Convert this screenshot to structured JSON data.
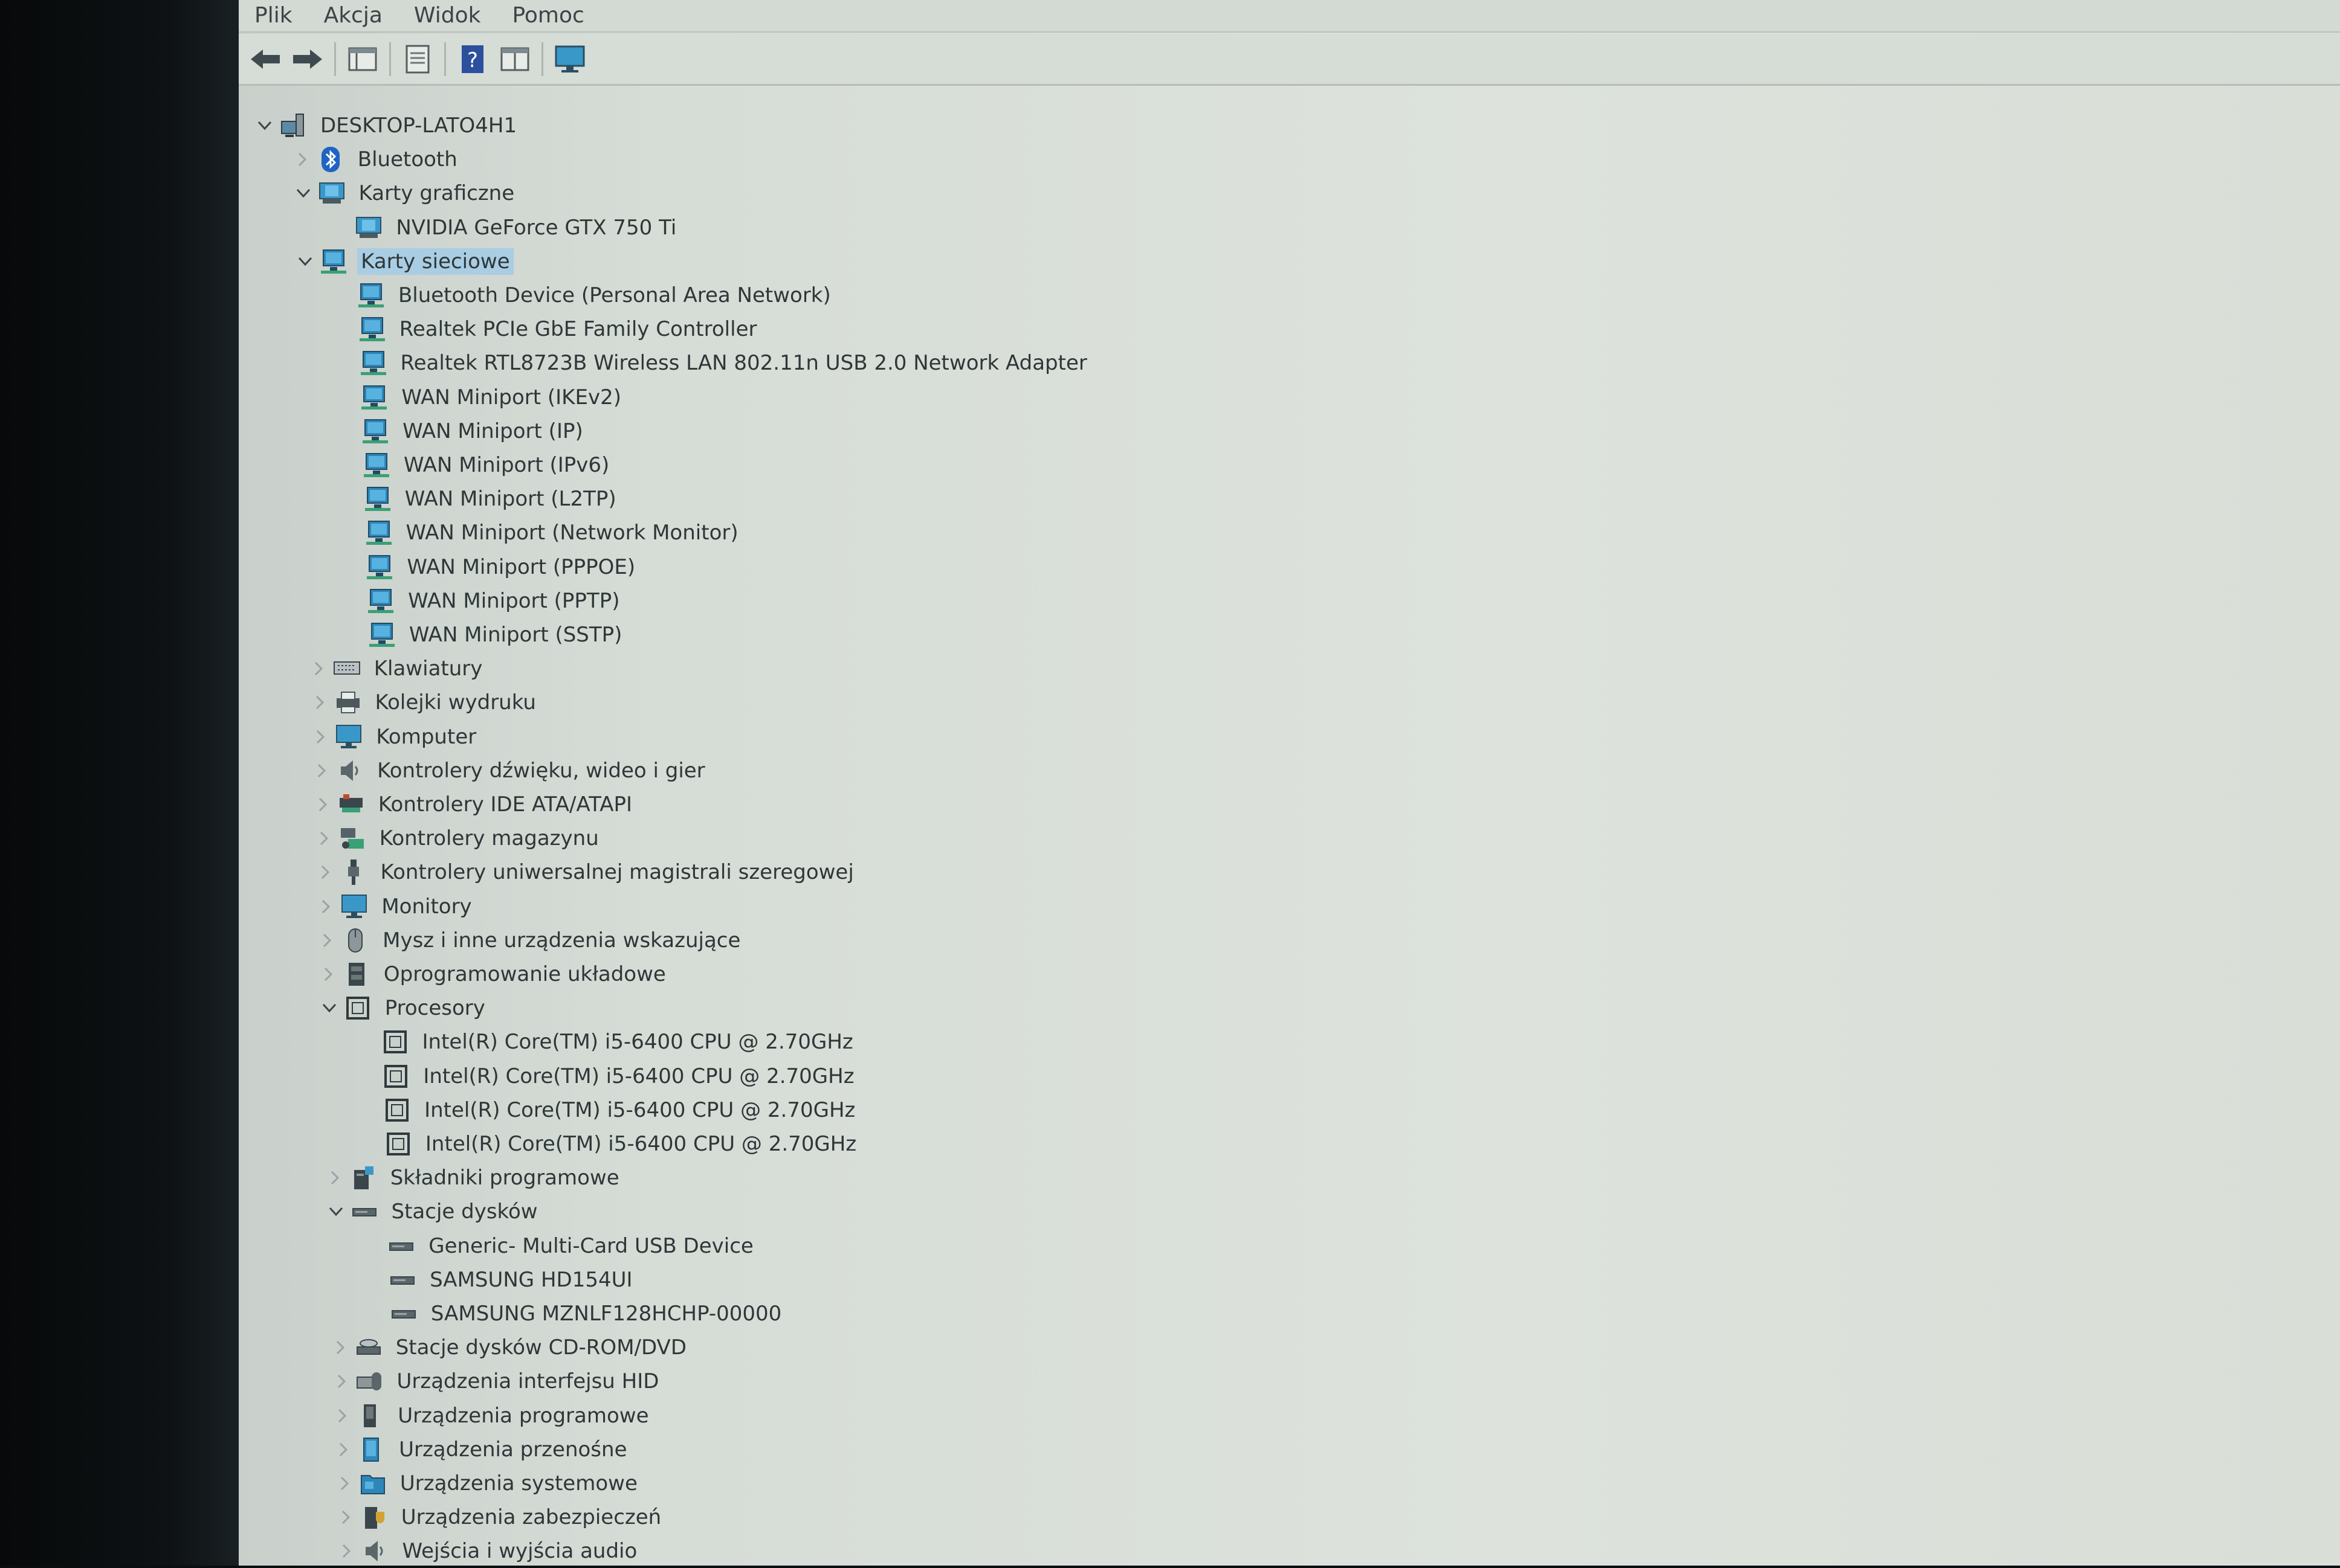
{
  "menu": [
    "Plik",
    "Akcja",
    "Widok",
    "Pomoc"
  ],
  "toolbar": {
    "buttons": [
      "back-arrow-icon",
      "forward-arrow-icon",
      "properties-window-icon",
      "document-list-icon",
      "help-icon",
      "panel-view-icon",
      "monitor-icon"
    ]
  },
  "tree": [
    {
      "label": "DESKTOP-LATO4H1",
      "level": 0,
      "toggle": "open",
      "icon": "computer-tower-icon"
    },
    {
      "label": "Bluetooth",
      "level": 1,
      "toggle": "closed",
      "icon": "bluetooth-icon"
    },
    {
      "label": "Karty graficzne",
      "level": 1,
      "toggle": "open",
      "icon": "display-adapter-icon"
    },
    {
      "label": "NVIDIA GeForce GTX 750 Ti",
      "level": 2,
      "toggle": "none",
      "icon": "display-adapter-icon"
    },
    {
      "label": "Karty sieciowe",
      "level": 1,
      "toggle": "open",
      "icon": "network-adapter-icon",
      "selected": true
    },
    {
      "label": "Bluetooth Device (Personal Area Network)",
      "level": 2,
      "toggle": "none",
      "icon": "network-adapter-icon"
    },
    {
      "label": "Realtek PCIe GbE Family Controller",
      "level": 2,
      "toggle": "none",
      "icon": "network-adapter-icon"
    },
    {
      "label": "Realtek RTL8723B Wireless LAN 802.11n USB 2.0 Network Adapter",
      "level": 2,
      "toggle": "none",
      "icon": "network-adapter-icon"
    },
    {
      "label": "WAN Miniport (IKEv2)",
      "level": 2,
      "toggle": "none",
      "icon": "network-adapter-icon"
    },
    {
      "label": "WAN Miniport (IP)",
      "level": 2,
      "toggle": "none",
      "icon": "network-adapter-icon"
    },
    {
      "label": "WAN Miniport (IPv6)",
      "level": 2,
      "toggle": "none",
      "icon": "network-adapter-icon"
    },
    {
      "label": "WAN Miniport (L2TP)",
      "level": 2,
      "toggle": "none",
      "icon": "network-adapter-icon"
    },
    {
      "label": "WAN Miniport (Network Monitor)",
      "level": 2,
      "toggle": "none",
      "icon": "network-adapter-icon"
    },
    {
      "label": "WAN Miniport (PPPOE)",
      "level": 2,
      "toggle": "none",
      "icon": "network-adapter-icon"
    },
    {
      "label": "WAN Miniport (PPTP)",
      "level": 2,
      "toggle": "none",
      "icon": "network-adapter-icon"
    },
    {
      "label": "WAN Miniport (SSTP)",
      "level": 2,
      "toggle": "none",
      "icon": "network-adapter-icon"
    },
    {
      "label": "Klawiatury",
      "level": 1,
      "toggle": "closed",
      "icon": "keyboard-icon"
    },
    {
      "label": "Kolejki wydruku",
      "level": 1,
      "toggle": "closed",
      "icon": "printer-icon"
    },
    {
      "label": "Komputer",
      "level": 1,
      "toggle": "closed",
      "icon": "monitor-icon"
    },
    {
      "label": "Kontrolery dźwięku, wideo i gier",
      "level": 1,
      "toggle": "closed",
      "icon": "speaker-icon"
    },
    {
      "label": "Kontrolery IDE ATA/ATAPI",
      "level": 1,
      "toggle": "closed",
      "icon": "ide-controller-icon"
    },
    {
      "label": "Kontrolery magazynu",
      "level": 1,
      "toggle": "closed",
      "icon": "storage-controller-icon"
    },
    {
      "label": "Kontrolery uniwersalnej magistrali szeregowej",
      "level": 1,
      "toggle": "closed",
      "icon": "usb-plug-icon"
    },
    {
      "label": "Monitory",
      "level": 1,
      "toggle": "closed",
      "icon": "monitor-icon"
    },
    {
      "label": "Mysz i inne urządzenia wskazujące",
      "level": 1,
      "toggle": "closed",
      "icon": "mouse-icon"
    },
    {
      "label": "Oprogramowanie układowe",
      "level": 1,
      "toggle": "closed",
      "icon": "firmware-chip-icon"
    },
    {
      "label": "Procesory",
      "level": 1,
      "toggle": "open",
      "icon": "processor-icon"
    },
    {
      "label": "Intel(R) Core(TM) i5-6400 CPU @ 2.70GHz",
      "level": 2,
      "toggle": "none",
      "icon": "processor-icon"
    },
    {
      "label": "Intel(R) Core(TM) i5-6400 CPU @ 2.70GHz",
      "level": 2,
      "toggle": "none",
      "icon": "processor-icon"
    },
    {
      "label": "Intel(R) Core(TM) i5-6400 CPU @ 2.70GHz",
      "level": 2,
      "toggle": "none",
      "icon": "processor-icon"
    },
    {
      "label": "Intel(R) Core(TM) i5-6400 CPU @ 2.70GHz",
      "level": 2,
      "toggle": "none",
      "icon": "processor-icon"
    },
    {
      "label": "Składniki programowe",
      "level": 1,
      "toggle": "closed",
      "icon": "software-component-icon"
    },
    {
      "label": "Stacje dysków",
      "level": 1,
      "toggle": "open",
      "icon": "disk-drive-icon"
    },
    {
      "label": "Generic- Multi-Card USB Device",
      "level": 2,
      "toggle": "none",
      "icon": "disk-drive-icon"
    },
    {
      "label": "SAMSUNG HD154UI",
      "level": 2,
      "toggle": "none",
      "icon": "disk-drive-icon"
    },
    {
      "label": "SAMSUNG MZNLF128HCHP-00000",
      "level": 2,
      "toggle": "none",
      "icon": "disk-drive-icon"
    },
    {
      "label": "Stacje dysków CD-ROM/DVD",
      "level": 1,
      "toggle": "closed",
      "icon": "cd-drive-icon"
    },
    {
      "label": "Urządzenia interfejsu HID",
      "level": 1,
      "toggle": "closed",
      "icon": "hid-device-icon"
    },
    {
      "label": "Urządzenia programowe",
      "level": 1,
      "toggle": "closed",
      "icon": "software-device-icon"
    },
    {
      "label": "Urządzenia przenośne",
      "level": 1,
      "toggle": "closed",
      "icon": "portable-device-icon"
    },
    {
      "label": "Urządzenia systemowe",
      "level": 1,
      "toggle": "closed",
      "icon": "system-devices-icon"
    },
    {
      "label": "Urządzenia zabezpieczeń",
      "level": 1,
      "toggle": "closed",
      "icon": "security-device-icon"
    },
    {
      "label": "Wejścia i wyjścia audio",
      "level": 1,
      "toggle": "closed",
      "icon": "speaker-icon"
    }
  ],
  "colors": {
    "selection": "#a9cde3",
    "text": "#2e3738",
    "network_icon": "#2f86b8",
    "background": "#dde3dc"
  }
}
